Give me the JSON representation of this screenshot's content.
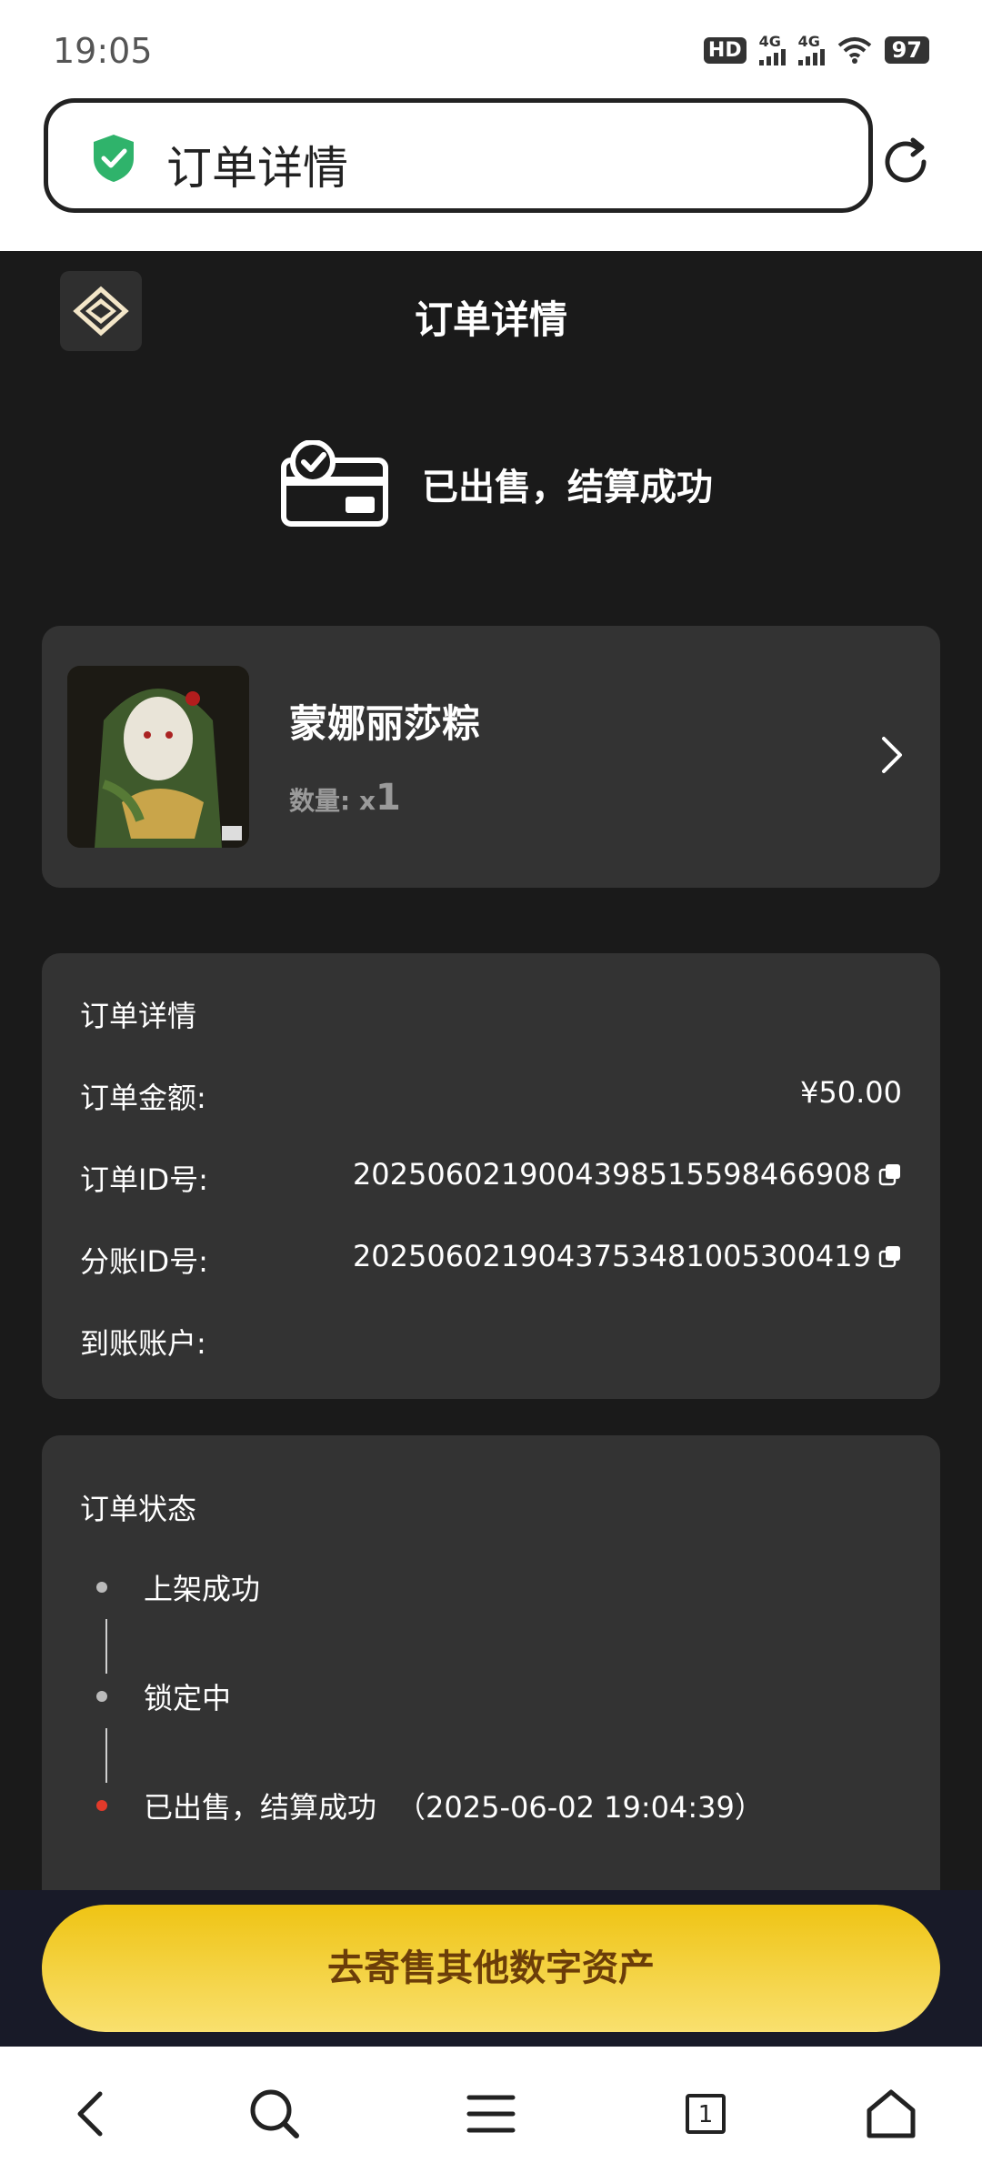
{
  "status_bar": {
    "time": "19:05",
    "hd_label": "HD",
    "sim1": "4G",
    "sim2": "4G",
    "battery": "97"
  },
  "browser": {
    "address_text": "订单详情",
    "tab_count": "1"
  },
  "header": {
    "title": "订单详情"
  },
  "banner": {
    "text": "已出售，结算成功"
  },
  "product": {
    "name": "蒙娜丽莎粽",
    "qty_label": "数量:",
    "qty_prefix": "x",
    "qty_value": "1"
  },
  "details": {
    "title": "订单详情",
    "rows": [
      {
        "label": "订单金额:",
        "value": "¥50.00"
      },
      {
        "label": "订单ID号:",
        "value": "20250602190043985155984669 08"
      },
      {
        "label": "分账ID号:",
        "value": "2025060219043753481005300419"
      },
      {
        "label": "到账账户:",
        "value": ""
      }
    ]
  },
  "order_status": {
    "title": "订单状态",
    "steps": [
      {
        "label": "上架成功"
      },
      {
        "label": "锁定中"
      },
      {
        "label": "已出售，结算成功",
        "time": "（2025-06-02 19:04:39）"
      }
    ]
  },
  "cta": {
    "label": "去寄售其他数字资产"
  },
  "colors": {
    "background": "#1a1a1a",
    "card": "#333333",
    "cta_gradient_top": "#efc414",
    "cta_text": "#6b3d09",
    "active_dot": "#e23a2a",
    "shield_green": "#2fb36b"
  }
}
